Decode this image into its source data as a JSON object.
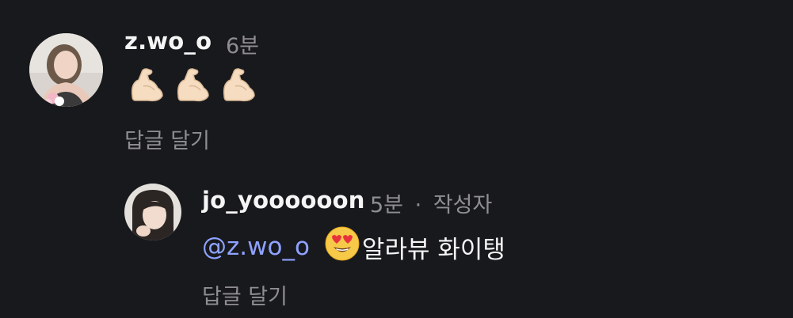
{
  "comments": [
    {
      "username": "z.wo_o",
      "time": "6분",
      "body_emojis": [
        "flexed-biceps",
        "flexed-biceps",
        "flexed-biceps"
      ],
      "reply_label": "답글 달기"
    }
  ],
  "replies": [
    {
      "username": "jo_yoooooon",
      "time": "5분",
      "separator": "·",
      "author_badge": "작성자",
      "mention": "@z.wo_o",
      "emoji": "heart-eyes-face",
      "text": "알라뷰 화이탱",
      "reply_label": "답글 달기"
    }
  ],
  "colors": {
    "background": "#18191d",
    "primary_text": "#f5f5f5",
    "secondary_text": "#8e8e93",
    "mention": "#8ea2ff"
  }
}
